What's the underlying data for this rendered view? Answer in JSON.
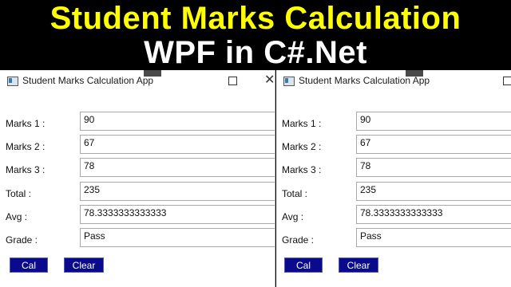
{
  "banner": {
    "line1": "Student Marks Calculation",
    "line2": "WPF in C#.Net"
  },
  "window": {
    "title": "Student Marks Calculation App",
    "maximize_glyph": "☐",
    "close_glyph": "✕"
  },
  "form": {
    "fields": [
      {
        "label": "Marks 1 :",
        "value": "90"
      },
      {
        "label": "Marks 2 :",
        "value": "67"
      },
      {
        "label": "Marks 3 :",
        "value": "78"
      },
      {
        "label": "Total :",
        "value": "235"
      },
      {
        "label": "Avg :",
        "value": "78.3333333333333"
      },
      {
        "label": "Grade :",
        "value": "Pass"
      }
    ],
    "cal_label": "Cal",
    "clear_label": "Clear"
  },
  "colors": {
    "banner_title": "#ffff00",
    "banner_subtitle": "#ffffff",
    "button_bg": "#0a0a8c"
  }
}
